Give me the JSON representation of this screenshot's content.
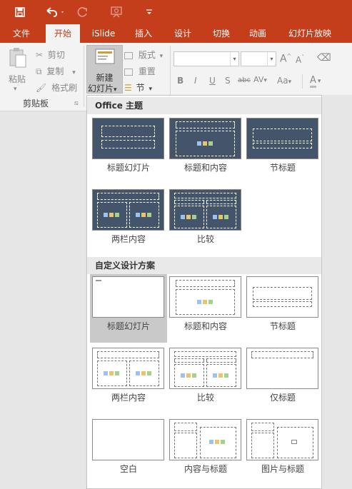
{
  "quick_access": {
    "save_icon": "save-icon",
    "undo_icon": "undo-icon",
    "redo_icon": "redo-icon",
    "presenter_icon": "slideshow-from-start-icon",
    "customize_icon": "customize-toolbar-icon"
  },
  "tabs": [
    {
      "label": "文件"
    },
    {
      "label": "开始",
      "active": true
    },
    {
      "label": "iSlide"
    },
    {
      "label": "插入"
    },
    {
      "label": "设计"
    },
    {
      "label": "切换"
    },
    {
      "label": "动画"
    },
    {
      "label": "幻灯片放映"
    }
  ],
  "clipboard": {
    "paste_label": "粘贴",
    "cut_label": "剪切",
    "copy_label": "复制",
    "format_painter_label": "格式刷",
    "group_label": "剪贴板"
  },
  "slides": {
    "new_slide_line1": "新建",
    "new_slide_line2": "幻灯片",
    "layout_label": "版式",
    "reset_label": "重置",
    "section_label": "节"
  },
  "font": {
    "family_value": "",
    "size_value": "",
    "bold": "B",
    "italic": "I",
    "underline": "U",
    "shadow": "S",
    "strike": "abc",
    "spacing": "AV",
    "case": "Aa",
    "color": "A",
    "grow": "A",
    "shrink": "A"
  },
  "dropdown": {
    "office_theme_title": "Office 主题",
    "office_layouts": [
      {
        "label": "标题幻灯片"
      },
      {
        "label": "标题和内容"
      },
      {
        "label": "节标题"
      },
      {
        "label": "两栏内容"
      },
      {
        "label": "比较"
      }
    ],
    "custom_title": "自定义设计方案",
    "custom_layouts": [
      {
        "label": "标题幻灯片",
        "selected": true
      },
      {
        "label": "标题和内容"
      },
      {
        "label": "节标题"
      },
      {
        "label": "两栏内容"
      },
      {
        "label": "比较"
      },
      {
        "label": "仅标题"
      },
      {
        "label": "空白"
      },
      {
        "label": "内容与标题"
      },
      {
        "label": "图片与标题"
      }
    ]
  },
  "colors": {
    "brand": "#c43e1c",
    "theme_thumb": "#44546a"
  }
}
